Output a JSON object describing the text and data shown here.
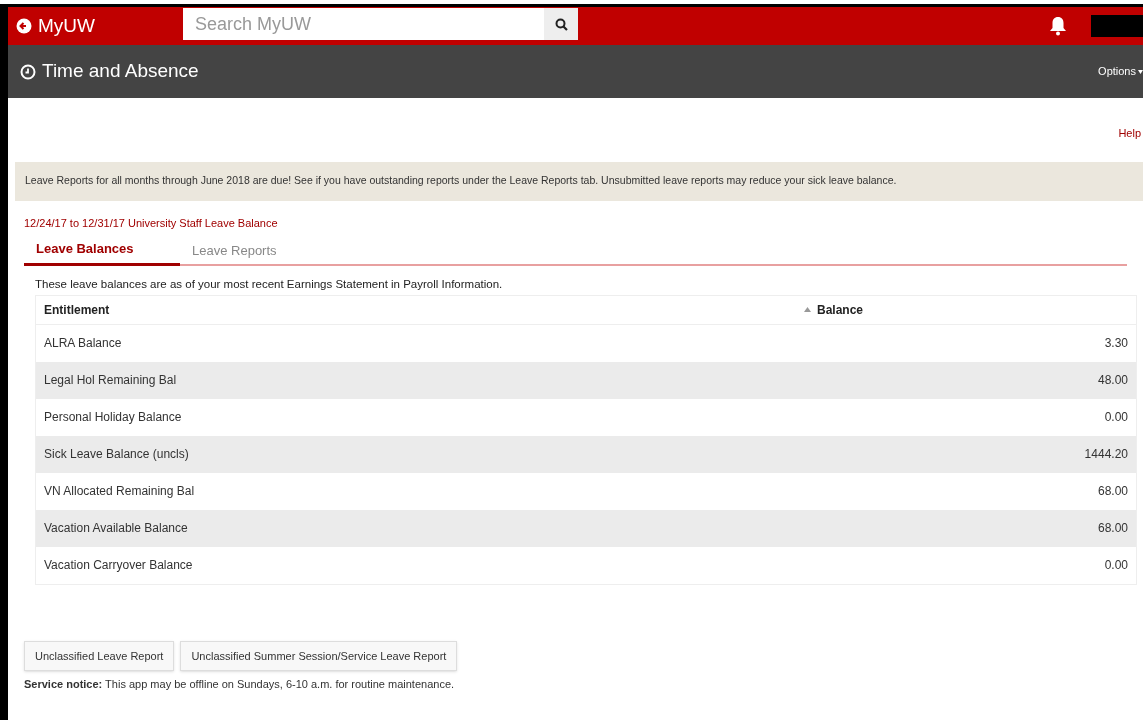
{
  "header": {
    "brand": "MyUW",
    "search": {
      "placeholder": "Search MyUW"
    }
  },
  "app_bar": {
    "title": "Time and Absence",
    "options": "Options"
  },
  "help": "Help",
  "banner": "Leave Reports for all months through June 2018 are due! See if you have outstanding reports under the Leave Reports tab. Unsubmitted leave reports may reduce your sick leave balance.",
  "period": "12/24/17 to 12/31/17 University Staff Leave Balance",
  "tabs": [
    {
      "label": "Leave Balances",
      "selected": true
    },
    {
      "label": "Leave Reports",
      "selected": false
    }
  ],
  "intro": "These leave balances are as of your most recent Earnings Statement in Payroll Information.",
  "table": {
    "columns": [
      "Entitlement",
      "Balance"
    ],
    "rows": [
      [
        "ALRA Balance",
        "3.30"
      ],
      [
        "Legal Hol Remaining Bal",
        "48.00"
      ],
      [
        "Personal Holiday Balance",
        "0.00"
      ],
      [
        "Sick Leave Balance (uncls)",
        "1444.20"
      ],
      [
        "VN Allocated Remaining Bal",
        "68.00"
      ],
      [
        "Vacation Available Balance",
        "68.00"
      ],
      [
        "Vacation Carryover Balance",
        "0.00"
      ]
    ]
  },
  "buttons": [
    "Unclassified Leave Report",
    "Unclassified Summer Session/Service Leave Report"
  ],
  "notice": "**Service notice:** This app may be offline on Sundays, 6-10 a.m. for routine maintenance."
}
